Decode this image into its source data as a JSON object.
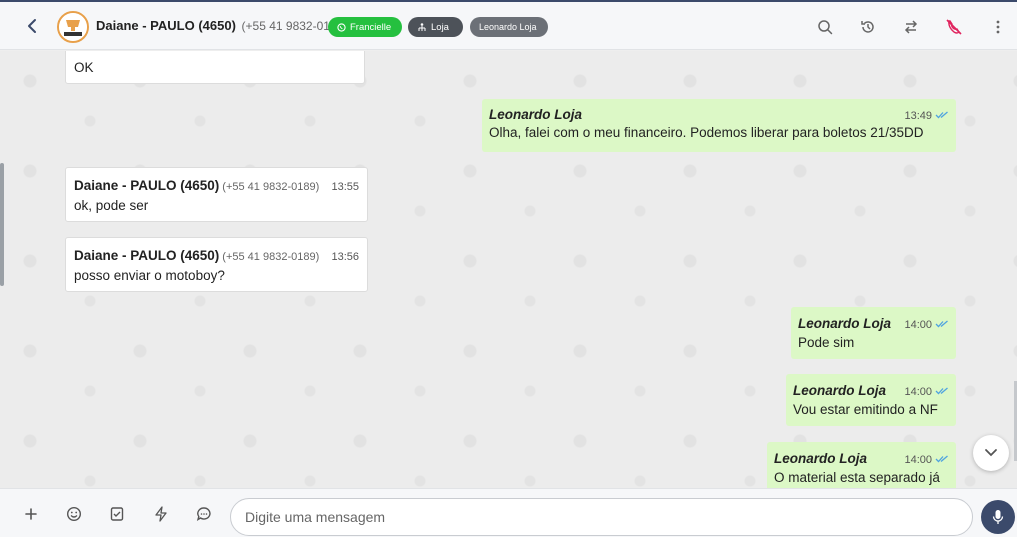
{
  "header": {
    "contact_name": "Daiane - PAULO (4650)",
    "contact_phone": "(+55 41 9832-0189)",
    "tags": {
      "whatsapp_user": "Francielle",
      "queue": "Loja",
      "agent": "Leonardo Loja"
    },
    "icons": [
      "back-arrow-icon",
      "search-icon",
      "history-icon",
      "transfer-icon",
      "close-ticket-icon",
      "more-options-icon"
    ],
    "colors": {
      "accent": "#3b4a6b",
      "green_tag": "#25c03f",
      "danger": "#e0245e"
    }
  },
  "messages": [
    {
      "direction": "in",
      "text": "OK"
    },
    {
      "direction": "out",
      "sender": "Leonardo Loja",
      "time": "13:49",
      "text": "Olha, falei com o meu financeiro. Podemos liberar para boletos 21/35DD"
    },
    {
      "direction": "in",
      "sender": "Daiane - PAULO (4650)",
      "phone": "(+55 41 9832-0189)",
      "time": "13:55",
      "text": "ok, pode ser"
    },
    {
      "direction": "in",
      "sender": "Daiane - PAULO (4650)",
      "phone": "(+55 41 9832-0189)",
      "time": "13:56",
      "text": "posso enviar o motoboy?"
    },
    {
      "direction": "out",
      "sender": "Leonardo Loja",
      "time": "14:00",
      "text": "Pode sim"
    },
    {
      "direction": "out",
      "sender": "Leonardo Loja",
      "time": "14:00",
      "text": "Vou estar emitindo a NF"
    },
    {
      "direction": "out",
      "sender": "Leonardo Loja",
      "time": "14:00",
      "text": "O material esta separado já"
    }
  ],
  "composer": {
    "placeholder": "Digite uma mensagem",
    "icons": [
      "plus-icon",
      "emoji-icon",
      "attachment-icon",
      "quick-reply-icon",
      "chat-icon",
      "microphone-icon"
    ]
  }
}
